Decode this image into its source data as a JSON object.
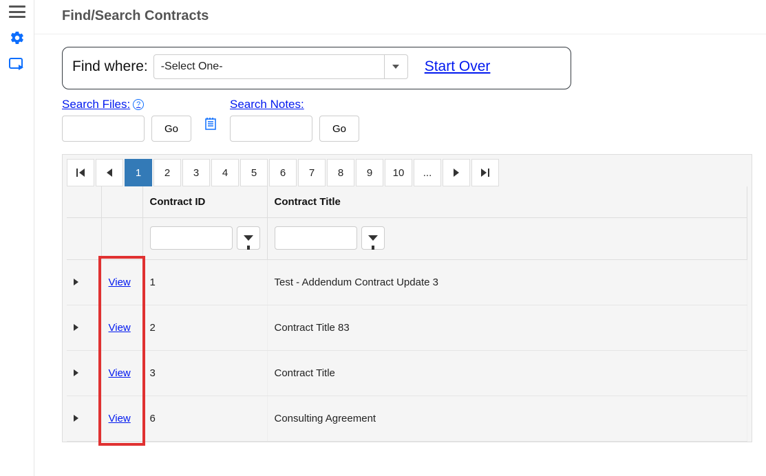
{
  "page_title": "Find/Search Contracts",
  "find": {
    "label": "Find where:",
    "select_placeholder": "-Select One-",
    "start_over": "Start Over"
  },
  "search_files": {
    "label": "Search Files:",
    "go": "Go"
  },
  "search_notes": {
    "label": "Search Notes:",
    "go": "Go"
  },
  "pager": {
    "pages": [
      "1",
      "2",
      "3",
      "4",
      "5",
      "6",
      "7",
      "8",
      "9",
      "10",
      "..."
    ],
    "active_index": 0
  },
  "columns": {
    "id": "Contract ID",
    "title": "Contract Title"
  },
  "view_label": "View",
  "rows": [
    {
      "id": "1",
      "title": "Test - Addendum Contract Update 3"
    },
    {
      "id": "2",
      "title": "Contract Title 83"
    },
    {
      "id": "3",
      "title": "Contract Title"
    },
    {
      "id": "6",
      "title": "Consulting Agreement"
    }
  ]
}
